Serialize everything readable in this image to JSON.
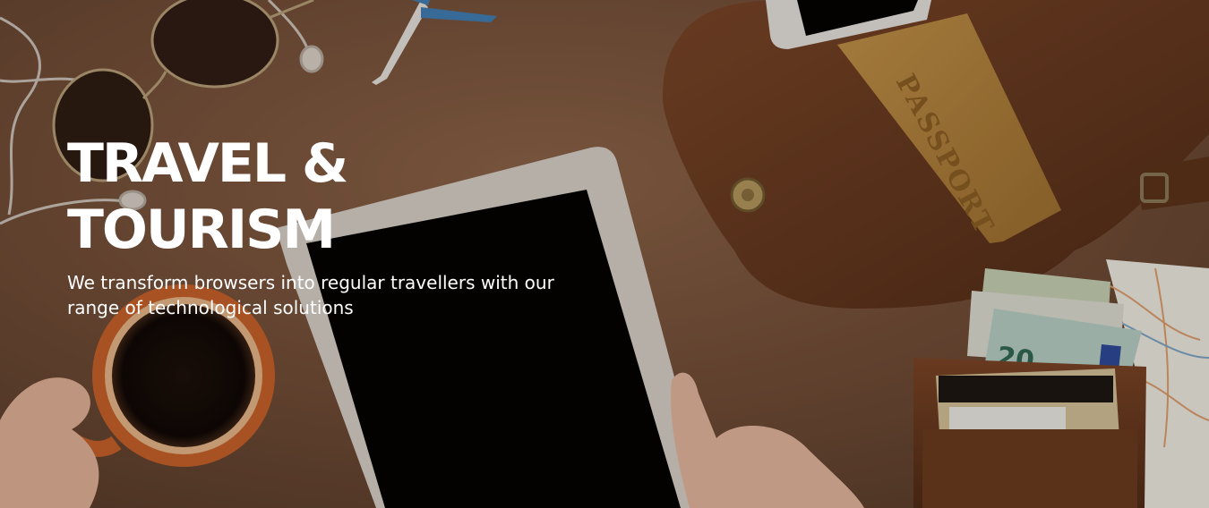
{
  "hero": {
    "title_line1": "TRAVEL &",
    "title_line2": "TOURISM",
    "subtitle": "We transform browsers into regular travellers with our range of technological solutions",
    "passport_text": "PASSPORT",
    "banknote_text": "20"
  },
  "colors": {
    "background": "#7a553d",
    "title": "#ffffff",
    "tablet_frame": "#d8d4cc",
    "tablet_screen": "#000000",
    "leather": "#6e3f22",
    "passport": "#b98a3c",
    "mug": "#c8622a"
  },
  "icons": {
    "sunglasses": "sunglasses-icon",
    "earphones": "earphones-icon",
    "airplane": "toy-airplane-icon",
    "tablet": "tablet-icon",
    "coffee": "coffee-mug-icon",
    "bag": "leather-bag-icon",
    "passport": "passport-icon",
    "phone": "phone-icon",
    "wallet": "wallet-icon",
    "map": "map-icon"
  }
}
